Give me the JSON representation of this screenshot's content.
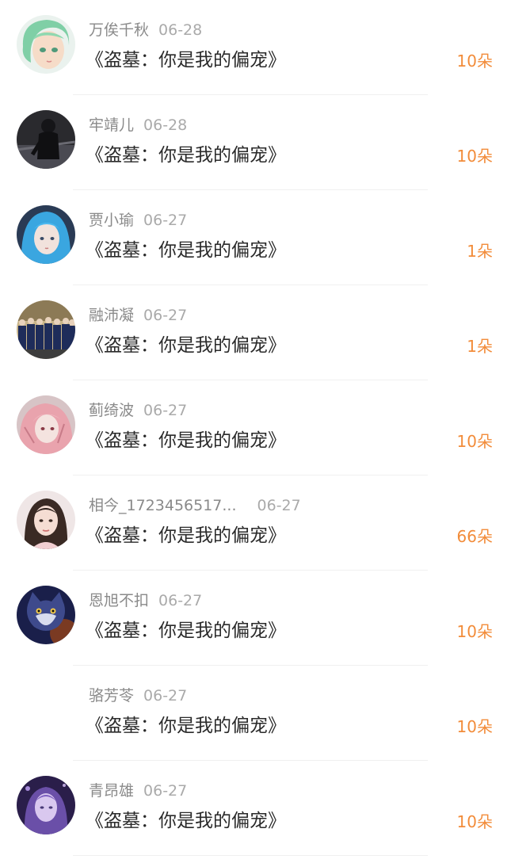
{
  "gifts": [
    {
      "name": "万俟千秋",
      "date": "06-28",
      "title": "《盗墓：你是我的偏宠》",
      "amount": "10朵",
      "avatar": "green-hair-avatar"
    },
    {
      "name": "牢靖儿",
      "date": "06-28",
      "title": "《盗墓：你是我的偏宠》",
      "amount": "10朵",
      "avatar": "dark-figure-avatar"
    },
    {
      "name": "贾小瑜",
      "date": "06-27",
      "title": "《盗墓：你是我的偏宠》",
      "amount": "1朵",
      "avatar": "blue-hair-avatar"
    },
    {
      "name": "融沛凝",
      "date": "06-27",
      "title": "《盗墓：你是我的偏宠》",
      "amount": "1朵",
      "avatar": "group-photo-avatar"
    },
    {
      "name": "蓟绮波",
      "date": "06-27",
      "title": "《盗墓：你是我的偏宠》",
      "amount": "10朵",
      "avatar": "pink-hair-avatar"
    },
    {
      "name": "相今_1723456517...",
      "date": "06-27",
      "title": "《盗墓：你是我的偏宠》",
      "amount": "66朵",
      "avatar": "girl-photo-avatar"
    },
    {
      "name": "恩旭不扣",
      "date": "06-27",
      "title": "《盗墓：你是我的偏宠》",
      "amount": "10朵",
      "avatar": "cat-avatar"
    },
    {
      "name": "骆芳苓",
      "date": "06-27",
      "title": "《盗墓：你是我的偏宠》",
      "amount": "10朵",
      "avatar": ""
    },
    {
      "name": "青昂雄",
      "date": "06-27",
      "title": "《盗墓：你是我的偏宠》",
      "amount": "10朵",
      "avatar": "purple-portrait-avatar"
    }
  ]
}
